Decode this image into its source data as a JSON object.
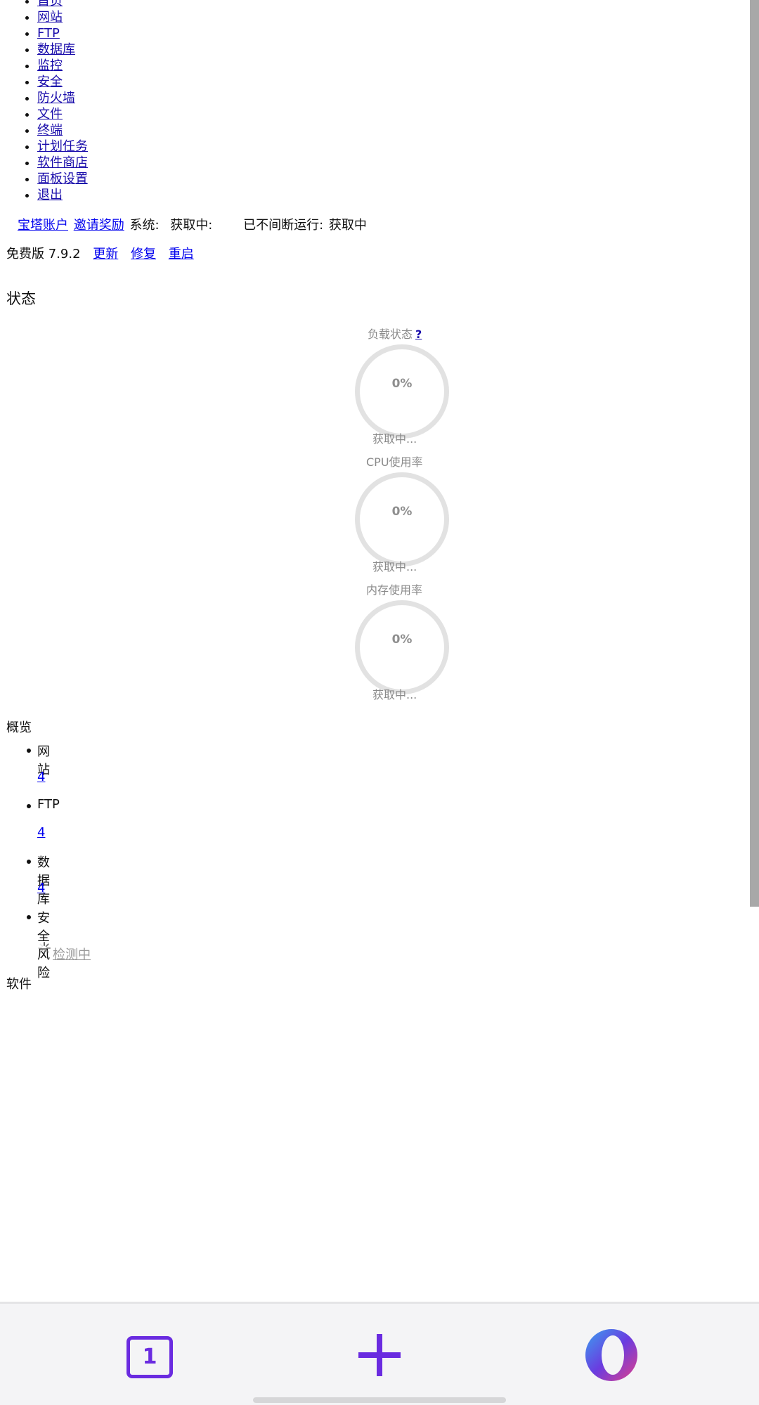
{
  "nav": {
    "items": [
      {
        "label": "首页"
      },
      {
        "label": "网站"
      },
      {
        "label": "FTP"
      },
      {
        "label": "数据库"
      },
      {
        "label": "监控"
      },
      {
        "label": "安全"
      },
      {
        "label": "防火墙"
      },
      {
        "label": "文件"
      },
      {
        "label": "终端"
      },
      {
        "label": "计划任务"
      },
      {
        "label": "软件商店"
      },
      {
        "label": "面板设置"
      },
      {
        "label": "退出"
      }
    ]
  },
  "system_line": {
    "account_link": "宝塔账户",
    "invite_link": "邀请奖励",
    "system_label": "系统:",
    "system_value": "获取中:",
    "uptime_label": "已不间断运行:",
    "uptime_value": "获取中"
  },
  "version_line": {
    "version": "免费版 7.9.2",
    "update_link": "更新",
    "repair_link": "修复",
    "restart_link": "重启"
  },
  "status": {
    "title": "状态",
    "gauges": [
      {
        "title": "负载状态",
        "help": "?",
        "value": "0%",
        "sub": "获取中..."
      },
      {
        "title": "CPU使用率",
        "value": "0%",
        "sub": "获取中..."
      },
      {
        "title": "内存使用率",
        "value": "0%",
        "sub": "获取中..."
      }
    ]
  },
  "overview": {
    "title": "概览",
    "items": [
      {
        "label": "网站",
        "value": "4"
      },
      {
        "label": "FTP",
        "value": "4"
      },
      {
        "label": "数据库",
        "value": "4"
      },
      {
        "label": "安全风险",
        "value": "检测中"
      }
    ]
  },
  "software": {
    "title": "软件"
  },
  "bottom_bar": {
    "tab_count": "1",
    "icons": [
      "tabs-icon",
      "plus-icon",
      "opera-icon"
    ],
    "accent": "#6a2be0"
  }
}
